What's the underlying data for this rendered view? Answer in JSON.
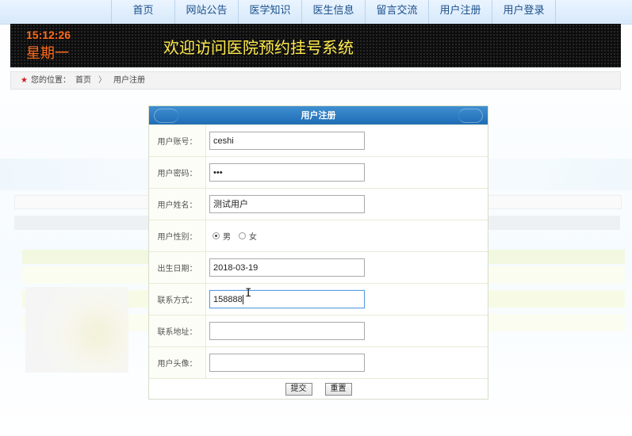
{
  "nav": {
    "items": [
      "首页",
      "网站公告",
      "医学知识",
      "医生信息",
      "留言交流",
      "用户注册",
      "用户登录"
    ]
  },
  "header": {
    "time": "15:12:26",
    "weekday": "星期一",
    "title": "欢迎访问医院预约挂号系统"
  },
  "breadcrumb": {
    "prefix": "您的位置：",
    "home": "首页",
    "separator": "〉",
    "current": "用户注册"
  },
  "form": {
    "title": "用户注册",
    "fields": {
      "account": {
        "label": "用户账号：",
        "value": "ceshi"
      },
      "password": {
        "label": "用户密码：",
        "value": "•••"
      },
      "name": {
        "label": "用户姓名：",
        "value": "测试用户"
      },
      "gender": {
        "label": "用户性别：",
        "male": "男",
        "female": "女",
        "selected": "男"
      },
      "birthday": {
        "label": "出生日期：",
        "value": "2018-03-19"
      },
      "phone": {
        "label": "联系方式：",
        "value": "158888"
      },
      "address": {
        "label": "联系地址：",
        "value": ""
      },
      "avatar": {
        "label": "用户头像：",
        "value": ""
      }
    },
    "submit_label": "提交",
    "reset_label": "重置"
  },
  "colors": {
    "accent": "#1f6cb5",
    "title_yellow": "#ffe94a",
    "clock_orange": "#ff6a1a"
  }
}
